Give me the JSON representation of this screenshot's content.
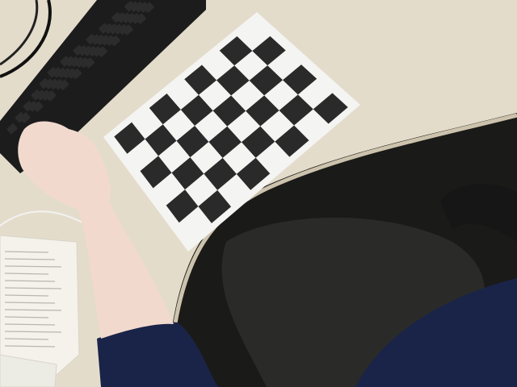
{
  "scene": {
    "subject": "checkerboard",
    "checkerboard": {
      "rows": 8,
      "columns": 6,
      "dark_color": "#2a2a2a",
      "light_color": "#f4f4f2"
    },
    "colors": {
      "desk": "#e4dccb",
      "desk_shadow": "#cdc3ad",
      "floor_shadow": "#1a1a18",
      "keyboard": "#1c1c1c",
      "key": "#2c2c2c",
      "skin": "#f1d9cd",
      "sleeve": "#1a2448",
      "trousers": "#2a2b28",
      "book_page": "#f4f2ea",
      "chair": "#161616"
    }
  }
}
